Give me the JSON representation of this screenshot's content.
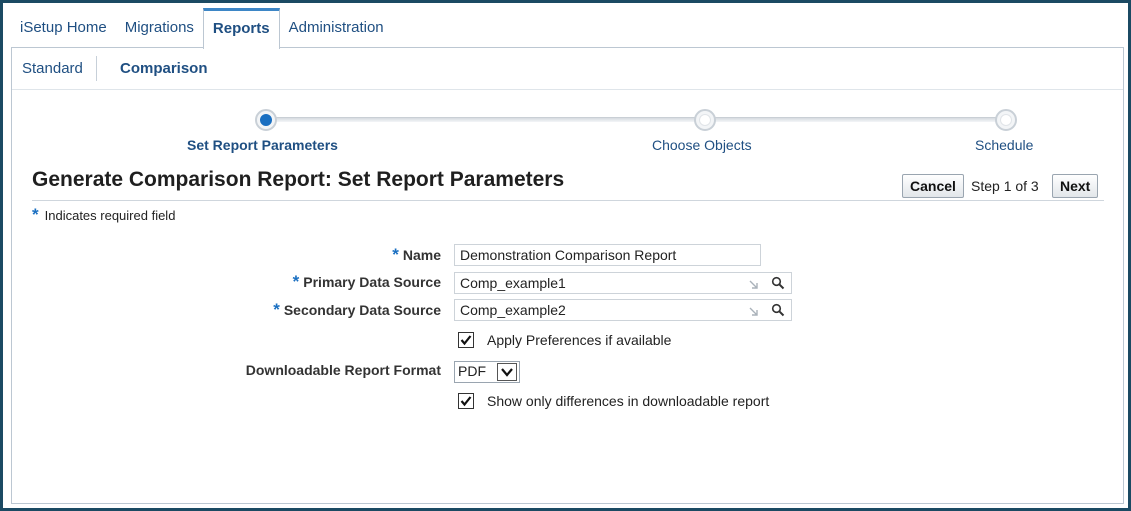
{
  "tabs": [
    {
      "label": "iSetup Home"
    },
    {
      "label": "Migrations"
    },
    {
      "label": "Reports"
    },
    {
      "label": "Administration"
    }
  ],
  "subtabs": [
    {
      "label": "Standard"
    },
    {
      "label": "Comparison"
    }
  ],
  "train": {
    "steps": [
      {
        "label": "Set Report Parameters"
      },
      {
        "label": "Choose Objects"
      },
      {
        "label": "Schedule"
      }
    ]
  },
  "page": {
    "title": "Generate Comparison Report: Set Report Parameters",
    "cancel_label": "Cancel",
    "step_text": "Step 1 of 3",
    "next_label": "Next",
    "required_star": "*",
    "required_note": "Indicates required field"
  },
  "form": {
    "name_label": "Name",
    "name_value": "Demonstration Comparison Report",
    "primary_label": "Primary Data Source",
    "primary_value": "Comp_example1",
    "secondary_label": "Secondary Data Source",
    "secondary_value": "Comp_example2",
    "apply_prefs_label": "Apply Preferences if available",
    "format_label": "Downloadable Report Format",
    "format_value": "PDF",
    "diff_only_label": "Show only differences in downloadable report"
  },
  "colors": {
    "accent": "#1a6fc1",
    "link": "#1f4f82",
    "frame": "#1b4a63"
  }
}
